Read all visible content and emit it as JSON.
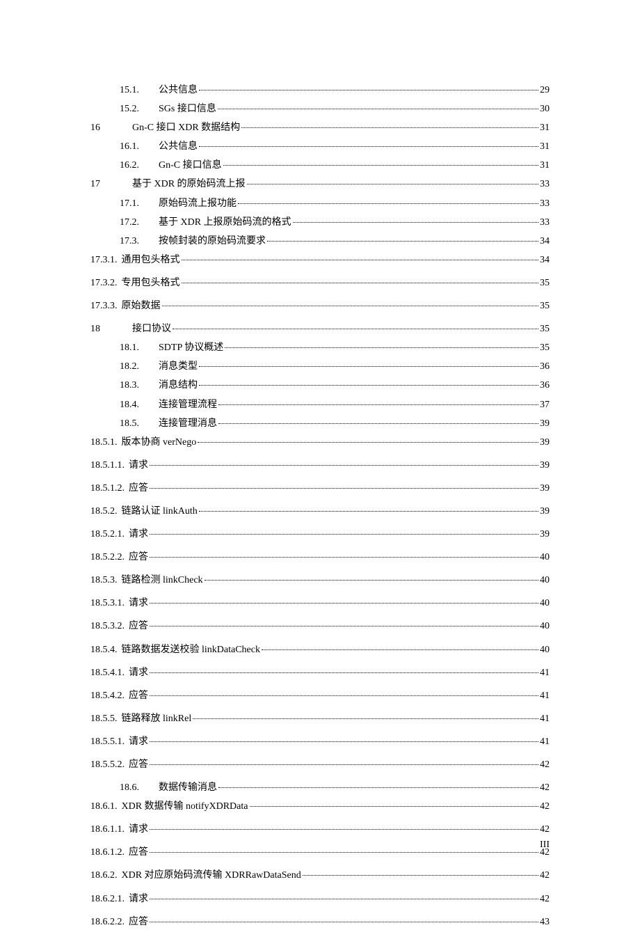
{
  "entries": [
    {
      "n": "15.1.",
      "t": "公共信息",
      "p": "29",
      "cls": "indent-sub2"
    },
    {
      "n": "15.2.",
      "t": "SGs 接口信息",
      "p": "30",
      "cls": "indent-sub2"
    },
    {
      "n": "16",
      "t": "Gn-C 接口 XDR 数据结构",
      "p": "31",
      "cls": "indent-lvl1"
    },
    {
      "n": "16.1.",
      "t": "公共信息",
      "p": "31",
      "cls": "indent-sub2"
    },
    {
      "n": "16.2.",
      "t": "Gn-C 接口信息",
      "p": "31",
      "cls": "indent-sub2"
    },
    {
      "n": "17",
      "t": "基于 XDR 的原始码流上报",
      "p": "33",
      "cls": "indent-lvl1"
    },
    {
      "n": "17.1.",
      "t": "原始码流上报功能",
      "p": "33",
      "cls": "indent-sub2"
    },
    {
      "n": "17.2.",
      "t": "基于 XDR 上报原始码流的格式",
      "p": "33",
      "cls": "indent-sub2"
    },
    {
      "n": "17.3.",
      "t": "按帧封装的原始码流要求",
      "p": "34",
      "cls": "indent-sub2"
    },
    {
      "n": "17.3.1.",
      "t": "通用包头格式",
      "p": "34",
      "cls": "indent-sub3",
      "spaced": true
    },
    {
      "n": "17.3.2.",
      "t": "专用包头格式",
      "p": "35",
      "cls": "indent-sub3",
      "spaced": true
    },
    {
      "n": "17.3.3.",
      "t": "原始数据",
      "p": "35",
      "cls": "indent-sub3",
      "spaced": true
    },
    {
      "n": "18",
      "t": "接口协议",
      "p": "35",
      "cls": "indent-lvl1"
    },
    {
      "n": "18.1.",
      "t": "SDTP 协议概述",
      "p": "35",
      "cls": "indent-sub2"
    },
    {
      "n": "18.2.",
      "t": "消息类型",
      "p": "36",
      "cls": "indent-sub2"
    },
    {
      "n": "18.3.",
      "t": "消息结构",
      "p": "36",
      "cls": "indent-sub2"
    },
    {
      "n": "18.4.",
      "t": "连接管理流程",
      "p": "37",
      "cls": "indent-sub2"
    },
    {
      "n": "18.5.",
      "t": "连接管理消息",
      "p": "39",
      "cls": "indent-sub2"
    },
    {
      "n": "18.5.1.",
      "t": "版本协商 verNego",
      "p": "39",
      "cls": "indent-sub3",
      "spaced": true
    },
    {
      "n": "18.5.1.1.",
      "t": "请求",
      "p": "39",
      "cls": "indent-sub3",
      "spaced": true
    },
    {
      "n": "18.5.1.2.",
      "t": "应答",
      "p": "39",
      "cls": "indent-sub3",
      "spaced": true
    },
    {
      "n": "18.5.2.",
      "t": "链路认证 linkAuth",
      "p": "39",
      "cls": "indent-sub3",
      "spaced": true
    },
    {
      "n": "18.5.2.1.",
      "t": "请求",
      "p": "39",
      "cls": "indent-sub3",
      "spaced": true
    },
    {
      "n": "18.5.2.2.",
      "t": "应答",
      "p": "40",
      "cls": "indent-sub3",
      "spaced": true
    },
    {
      "n": "18.5.3.",
      "t": "链路检测 linkCheck",
      "p": "40",
      "cls": "indent-sub3",
      "spaced": true
    },
    {
      "n": "18.5.3.1.",
      "t": "请求",
      "p": "40",
      "cls": "indent-sub3",
      "spaced": true
    },
    {
      "n": "18.5.3.2.",
      "t": "应答",
      "p": "40",
      "cls": "indent-sub3",
      "spaced": true
    },
    {
      "n": "18.5.4.",
      "t": "链路数据发送校验 linkDataCheck",
      "p": "40",
      "cls": "indent-sub3",
      "spaced": true
    },
    {
      "n": "18.5.4.1.",
      "t": "请求",
      "p": "41",
      "cls": "indent-sub3",
      "spaced": true
    },
    {
      "n": "18.5.4.2.",
      "t": "应答",
      "p": "41",
      "cls": "indent-sub3",
      "spaced": true
    },
    {
      "n": "18.5.5.",
      "t": "链路释放 linkRel",
      "p": "41",
      "cls": "indent-sub3",
      "spaced": true
    },
    {
      "n": "18.5.5.1.",
      "t": "请求",
      "p": "41",
      "cls": "indent-sub3",
      "spaced": true
    },
    {
      "n": "18.5.5.2.",
      "t": "应答",
      "p": "42",
      "cls": "indent-sub3",
      "spaced": true
    },
    {
      "n": "18.6.",
      "t": "数据传输消息",
      "p": "42",
      "cls": "indent-sub2"
    },
    {
      "n": "18.6.1.",
      "t": "XDR 数据传输 notifyXDRData",
      "p": "42",
      "cls": "indent-sub3",
      "spaced": true
    },
    {
      "n": "18.6.1.1.",
      "t": "请求",
      "p": "42",
      "cls": "indent-sub3",
      "spaced": true
    },
    {
      "n": "18.6.1.2.",
      "t": "应答",
      "p": "42",
      "cls": "indent-sub3",
      "spaced": true
    },
    {
      "n": "18.6.2.",
      "t": "XDR 对应原始码流传输 XDRRawDataSend",
      "p": "42",
      "cls": "indent-sub3",
      "spaced": true
    },
    {
      "n": "18.6.2.1.",
      "t": "请求",
      "p": "42",
      "cls": "indent-sub3",
      "spaced": true
    },
    {
      "n": "18.6.2.2.",
      "t": "应答",
      "p": "43",
      "cls": "indent-sub3",
      "spaced": true
    }
  ],
  "footer_page": "III"
}
